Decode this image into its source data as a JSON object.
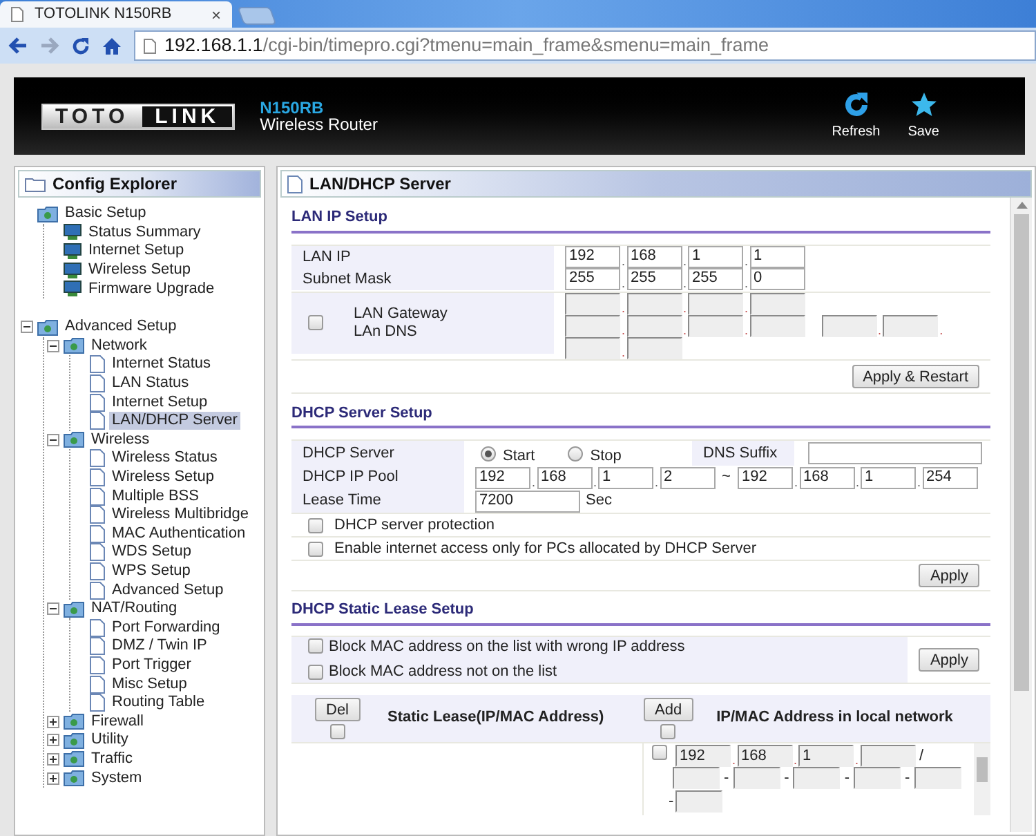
{
  "browser": {
    "tab_title": "TOTOLINK N150RB",
    "close": "×",
    "url_host": "192.168.1.1",
    "url_path": "/cgi-bin/timepro.cgi?tmenu=main_frame&smenu=main_frame"
  },
  "header": {
    "logo_left": "TOTO",
    "logo_right": "LINK",
    "model": "N150RB",
    "product": "Wireless Router",
    "actions": [
      {
        "kind": "refresh",
        "label": "Refresh"
      },
      {
        "kind": "save",
        "label": "Save"
      }
    ]
  },
  "sidebar": {
    "title": "Config Explorer",
    "tree": [
      {
        "label": "Basic Setup",
        "kind": "section",
        "children": [
          {
            "label": "Status Summary",
            "kind": "shortcut",
            "selected": false
          },
          {
            "label": "Internet Setup",
            "kind": "shortcut",
            "selected": false
          },
          {
            "label": "Wireless Setup",
            "kind": "shortcut",
            "selected": false
          },
          {
            "label": "Firmware Upgrade",
            "kind": "shortcut",
            "selected": false
          }
        ]
      },
      {
        "label": "Advanced Setup",
        "kind": "folder",
        "expanded": true,
        "children": [
          {
            "label": "Network",
            "kind": "folder",
            "expanded": true,
            "children": [
              {
                "label": "Internet Status",
                "kind": "page",
                "selected": false
              },
              {
                "label": "LAN Status",
                "kind": "page",
                "selected": false
              },
              {
                "label": "Internet Setup",
                "kind": "page",
                "selected": false
              },
              {
                "label": "LAN/DHCP Server",
                "kind": "page",
                "selected": true
              }
            ]
          },
          {
            "label": "Wireless",
            "kind": "folder",
            "expanded": true,
            "children": [
              {
                "label": "Wireless Status",
                "kind": "page",
                "selected": false
              },
              {
                "label": "Wireless Setup",
                "kind": "page",
                "selected": false
              },
              {
                "label": "Multiple BSS",
                "kind": "page",
                "selected": false
              },
              {
                "label": "Wireless Multibridge",
                "kind": "page",
                "selected": false
              },
              {
                "label": "MAC Authentication",
                "kind": "page",
                "selected": false
              },
              {
                "label": "WDS Setup",
                "kind": "page",
                "selected": false
              },
              {
                "label": "WPS Setup",
                "kind": "page",
                "selected": false
              },
              {
                "label": "Advanced Setup",
                "kind": "page",
                "selected": false
              }
            ]
          },
          {
            "label": "NAT/Routing",
            "kind": "folder",
            "expanded": true,
            "children": [
              {
                "label": "Port Forwarding",
                "kind": "page",
                "selected": false
              },
              {
                "label": "DMZ / Twin IP",
                "kind": "page",
                "selected": false
              },
              {
                "label": "Port Trigger",
                "kind": "page",
                "selected": false
              },
              {
                "label": "Misc Setup",
                "kind": "page",
                "selected": false
              },
              {
                "label": "Routing Table",
                "kind": "page",
                "selected": false
              }
            ]
          },
          {
            "label": "Firewall",
            "kind": "folder",
            "expanded": false
          },
          {
            "label": "Utility",
            "kind": "folder",
            "expanded": false
          },
          {
            "label": "Traffic",
            "kind": "folder",
            "expanded": false
          },
          {
            "label": "System",
            "kind": "folder",
            "expanded": false
          }
        ]
      }
    ]
  },
  "panel": {
    "title": "LAN/DHCP Server",
    "lan": {
      "heading": "LAN IP Setup",
      "separator": ".",
      "rows": [
        {
          "label": "LAN IP",
          "octets": [
            "192",
            "168",
            "1",
            "1"
          ]
        },
        {
          "label": "Subnet Mask",
          "octets": [
            "255",
            "255",
            "255",
            "0"
          ]
        }
      ],
      "gateway": {
        "checked": false,
        "labels": [
          "LAN Gateway",
          "LAn DNS"
        ]
      },
      "button": "Apply & Restart"
    },
    "dhcp": {
      "heading": "DHCP Server Setup",
      "server_label": "DHCP Server",
      "options": [
        {
          "label": "Start",
          "selected": true
        },
        {
          "label": "Stop",
          "selected": false
        }
      ],
      "dns_suffix_label": "DNS Suffix",
      "pool_label": "DHCP IP Pool",
      "pool_start": [
        "192",
        "168",
        "1",
        "2"
      ],
      "range_separator": "~",
      "pool_end": [
        "192",
        "168",
        "1",
        "254"
      ],
      "lease_label": "Lease Time",
      "lease": "7200",
      "lease_unit": "Sec",
      "checks": [
        {
          "label": "DHCP server protection",
          "checked": false
        },
        {
          "label": "Enable internet access only for PCs allocated by DHCP Server",
          "checked": false
        }
      ],
      "button": "Apply"
    },
    "static": {
      "heading": "DHCP Static Lease Setup",
      "checks": [
        {
          "label": "Block MAC address on the list with wrong IP address",
          "checked": false
        },
        {
          "label": "Block MAC address not on the list",
          "checked": false
        }
      ],
      "button": "Apply",
      "del_button": "Del",
      "left_header": "Static Lease(IP/MAC Address)",
      "left_all_checked": false,
      "add_button": "Add",
      "right_header": "IP/MAC Address in local network",
      "right_all_checked": false,
      "entry": {
        "checked": false,
        "ip": [
          "192",
          "168",
          "1"
        ],
        "ip_mac_separator": "/",
        "mac_separator": "-"
      }
    }
  }
}
